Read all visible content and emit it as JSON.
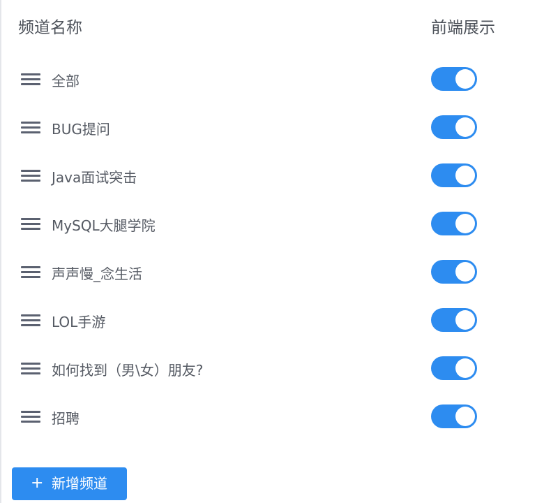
{
  "header": {
    "name_column": "频道名称",
    "display_column": "前端展示"
  },
  "channels": [
    {
      "label": "全部",
      "frontend_display": true
    },
    {
      "label": "BUG提问",
      "frontend_display": true
    },
    {
      "label": "Java面试突击",
      "frontend_display": true
    },
    {
      "label": "MySQL大腿学院",
      "frontend_display": true
    },
    {
      "label": "声声慢_念生活",
      "frontend_display": true
    },
    {
      "label": "LOL手游",
      "frontend_display": true
    },
    {
      "label": "如何找到（男\\女）朋友?",
      "frontend_display": true
    },
    {
      "label": "招聘",
      "frontend_display": true
    }
  ],
  "add_button": {
    "icon": "plus-icon",
    "label": "新增频道"
  },
  "colors": {
    "accent": "#2d8cf0",
    "text": "#555a63",
    "handle": "#5b6170"
  }
}
